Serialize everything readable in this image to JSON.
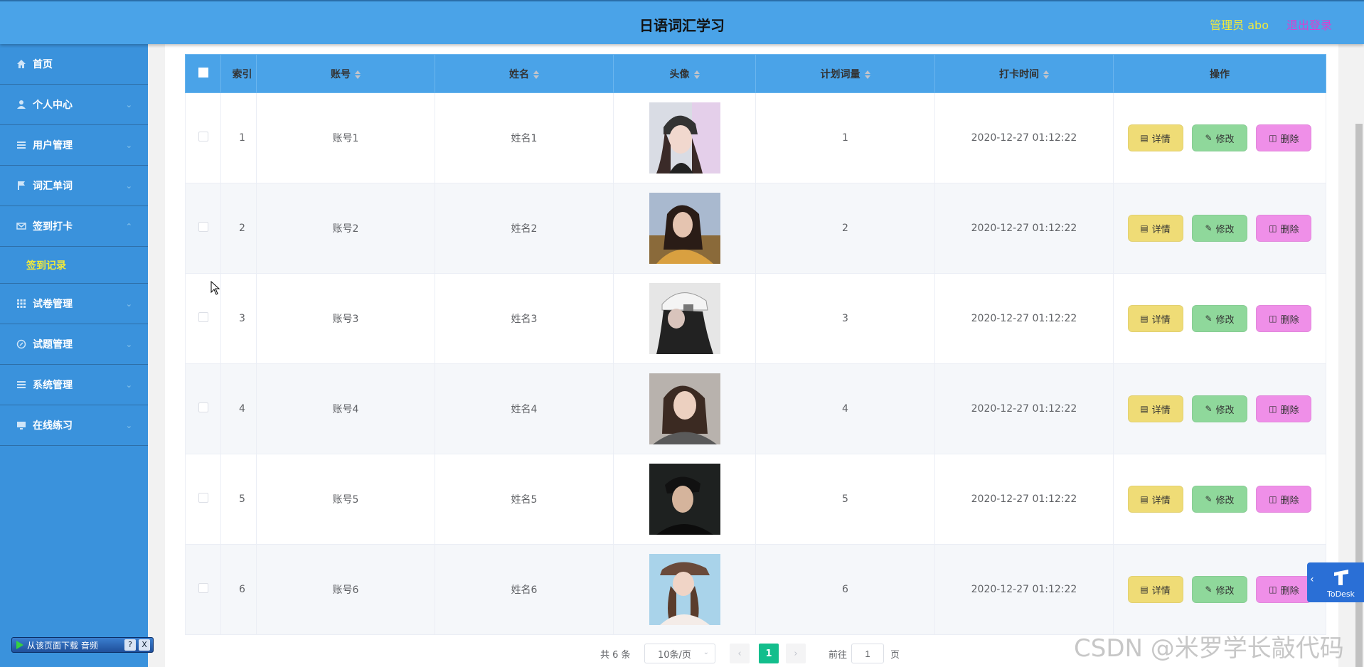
{
  "header": {
    "title": "日语词汇学习",
    "admin": "管理员 abo",
    "logout": "退出登录"
  },
  "sidebar": {
    "items": [
      {
        "label": "首页",
        "icon": "home-icon"
      },
      {
        "label": "个人中心",
        "icon": "user-icon"
      },
      {
        "label": "用户管理",
        "icon": "menu-icon"
      },
      {
        "label": "词汇单词",
        "icon": "flag-icon"
      },
      {
        "label": "签到打卡",
        "icon": "mail-icon"
      },
      {
        "label": "试卷管理",
        "icon": "grid-icon"
      },
      {
        "label": "试题管理",
        "icon": "compass-icon"
      },
      {
        "label": "系统管理",
        "icon": "menu-icon"
      },
      {
        "label": "在线练习",
        "icon": "monitor-icon"
      }
    ],
    "sub_active": "签到记录"
  },
  "table": {
    "headers": {
      "index": "索引",
      "account": "账号",
      "name": "姓名",
      "avatar": "头像",
      "plan": "计划词量",
      "checkin": "打卡时间",
      "ops": "操作"
    },
    "rows": [
      {
        "index": "1",
        "account": "账号1",
        "name": "姓名1",
        "plan": "1",
        "time": "2020-12-27 01:12:22"
      },
      {
        "index": "2",
        "account": "账号2",
        "name": "姓名2",
        "plan": "2",
        "time": "2020-12-27 01:12:22"
      },
      {
        "index": "3",
        "account": "账号3",
        "name": "姓名3",
        "plan": "3",
        "time": "2020-12-27 01:12:22"
      },
      {
        "index": "4",
        "account": "账号4",
        "name": "姓名4",
        "plan": "4",
        "time": "2020-12-27 01:12:22"
      },
      {
        "index": "5",
        "account": "账号5",
        "name": "姓名5",
        "plan": "5",
        "time": "2020-12-27 01:12:22"
      },
      {
        "index": "6",
        "account": "账号6",
        "name": "姓名6",
        "plan": "6",
        "time": "2020-12-27 01:12:22"
      }
    ],
    "buttons": {
      "detail": "详情",
      "edit": "修改",
      "delete": "删除"
    }
  },
  "pager": {
    "total": "共 6 条",
    "size": "10条/页",
    "current": "1",
    "goto": "前往",
    "goto_value": "1",
    "unit": "页"
  },
  "todesk": {
    "label": "ToDesk"
  },
  "download_bar": {
    "label": "从该页面下载 音频",
    "help": "?",
    "close": "X"
  },
  "watermark": "CSDN @米罗学长敲代码",
  "colors": {
    "header_bg": "#4aa3e8",
    "sidebar_bg": "#3a92dc",
    "active_text": "#f2ea3a",
    "logout_text": "#d93fd0",
    "detail_btn": "#efdc76",
    "edit_btn": "#8fd89b",
    "delete_btn": "#ef8fe8",
    "page_active": "#13be8c"
  }
}
